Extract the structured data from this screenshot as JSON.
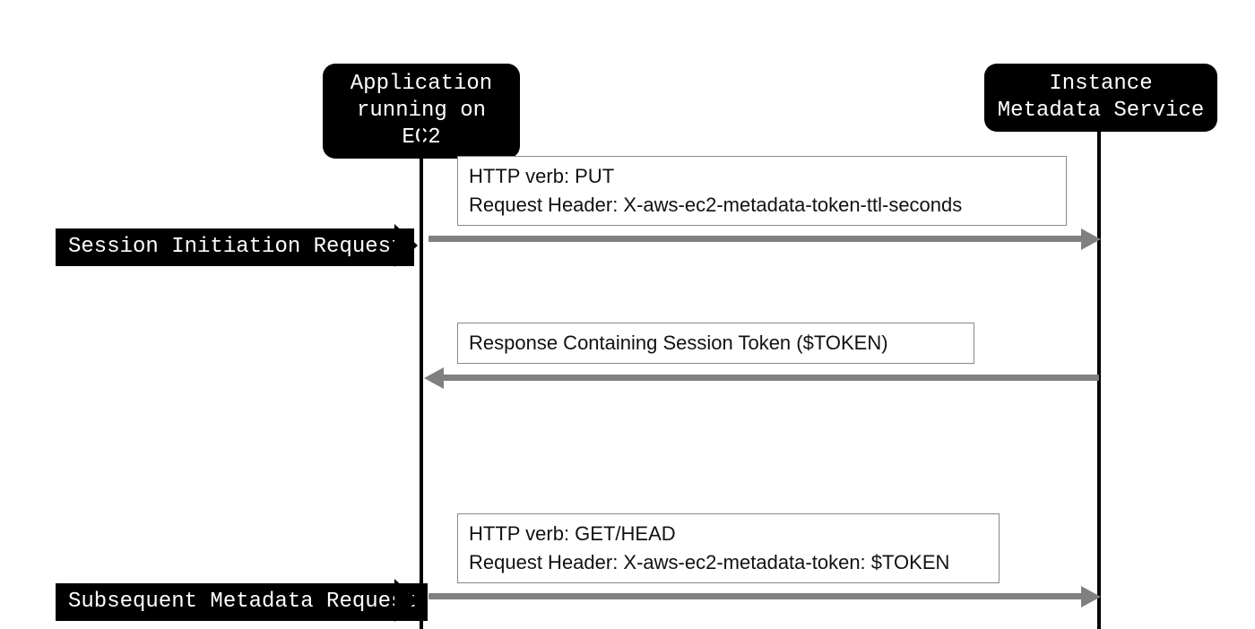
{
  "actors": {
    "left": "Application\nrunning on EC2",
    "right": "Instance\nMetadata Service"
  },
  "flows": {
    "initiation": {
      "label": "Session Initiation Request",
      "detail": "HTTP verb: PUT\nRequest Header: X-aws-ec2-metadata-token-ttl-seconds"
    },
    "response": {
      "detail": "Response Containing Session Token ($TOKEN)"
    },
    "subsequent": {
      "label": "Subsequent Metadata Request",
      "detail": "HTTP verb: GET/HEAD\nRequest Header: X-aws-ec2-metadata-token: $TOKEN"
    }
  }
}
